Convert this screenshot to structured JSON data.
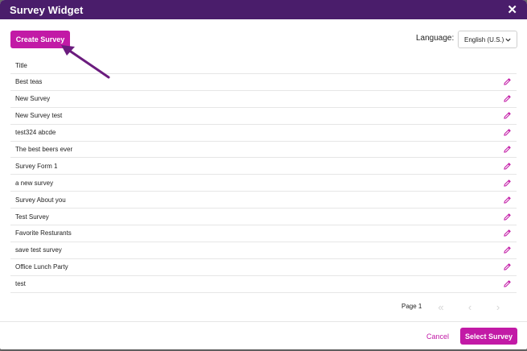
{
  "window": {
    "title": "Survey Widget",
    "close_icon": "close-icon"
  },
  "toolbar": {
    "create_label": "Create Survey",
    "language_label": "Language:",
    "language_value": "English (U.S.)"
  },
  "table": {
    "header_title": "Title",
    "rows": [
      {
        "title": "Best teas"
      },
      {
        "title": "New Survey"
      },
      {
        "title": "New Survey test"
      },
      {
        "title": "test324 abcde"
      },
      {
        "title": "The best beers ever"
      },
      {
        "title": "Survey Form 1"
      },
      {
        "title": "a new survey"
      },
      {
        "title": "Survey About you"
      },
      {
        "title": "Test Survey"
      },
      {
        "title": "Favorite Resturants"
      },
      {
        "title": "save test survey"
      },
      {
        "title": "Office Lunch Party"
      },
      {
        "title": "test"
      }
    ]
  },
  "pagination": {
    "page_label": "Page 1",
    "first_icon": "double-chevron-left-icon",
    "prev_icon": "chevron-left-icon",
    "next_icon": "chevron-right-icon"
  },
  "footer": {
    "cancel_label": "Cancel",
    "select_label": "Select Survey"
  },
  "colors": {
    "titlebar": "#4a1d6b",
    "accent": "#c21aa6",
    "annotation_arrow": "#6b1c7e"
  }
}
